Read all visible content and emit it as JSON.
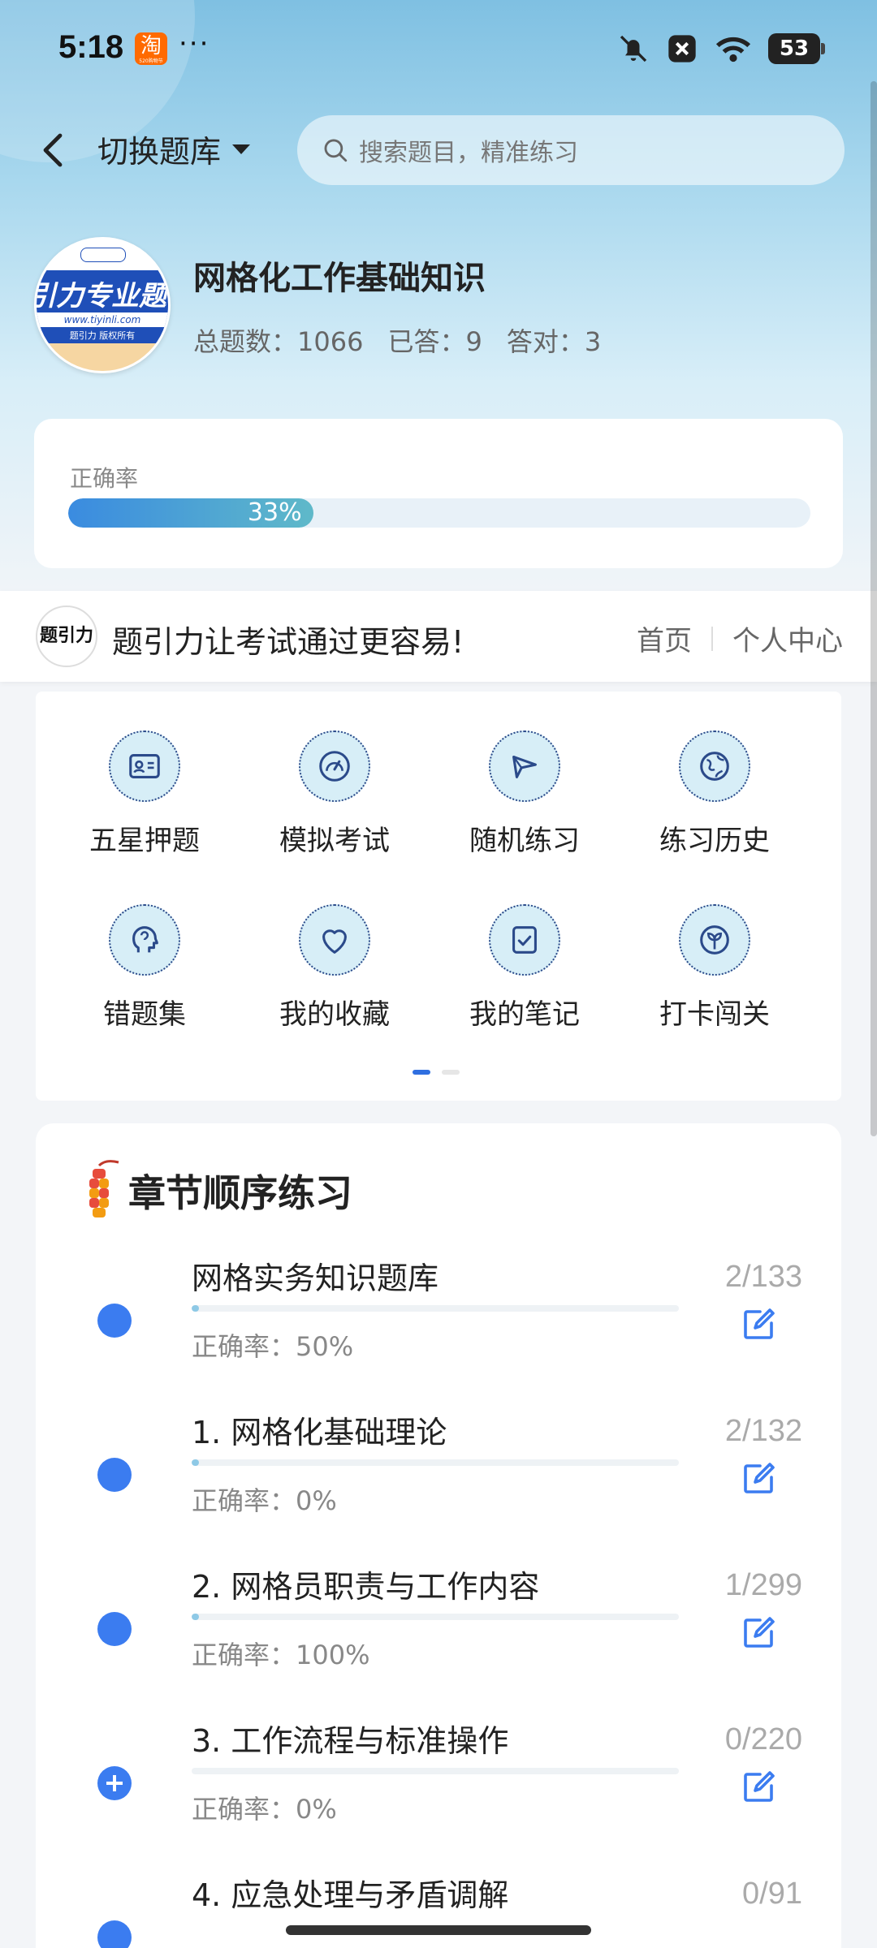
{
  "status_bar": {
    "time": "5:18",
    "app_badge": "淘",
    "app_badge_sub": "520购物节",
    "more": "···",
    "battery": "53"
  },
  "nav": {
    "switch_label": "切换题库",
    "search_placeholder": "搜索题目，精准练习"
  },
  "bank": {
    "avatar_text": "引力专业题",
    "avatar_url": "www.tiyinli.com",
    "avatar_copyright": "题引力 版权所有",
    "title": "网格化工作基础知识",
    "stats": {
      "total_label": "总题数：1066",
      "answered_label": "已答：9",
      "correct_label": "答对：3"
    }
  },
  "accuracy": {
    "label": "正确率",
    "percent_text": "33%",
    "value": 0.33
  },
  "banner": {
    "logo_text": "题引力",
    "slogan": "题引力让考试通过更容易!",
    "links": [
      "首页",
      "个人中心"
    ]
  },
  "features": [
    {
      "label": "五星押题",
      "icon": "id-card-icon"
    },
    {
      "label": "模拟考试",
      "icon": "gauge-icon"
    },
    {
      "label": "随机练习",
      "icon": "shuffle-icon"
    },
    {
      "label": "练习历史",
      "icon": "globe-icon"
    },
    {
      "label": "错题集",
      "icon": "brain-head-icon"
    },
    {
      "label": "我的收藏",
      "icon": "heart-icon"
    },
    {
      "label": "我的笔记",
      "icon": "note-check-icon"
    },
    {
      "label": "打卡闯关",
      "icon": "sprout-icon"
    }
  ],
  "pager": {
    "pages": 2,
    "active": 0
  },
  "chapters_section": {
    "title": "章节顺序练习",
    "items": [
      {
        "name": "网格实务知识题库",
        "count": "2/133",
        "accuracy": "正确率：50%",
        "progress": 0.015,
        "status": "dot"
      },
      {
        "name": "1. 网格化基础理论",
        "count": "2/132",
        "accuracy": "正确率：0%",
        "progress": 0.015,
        "status": "dot"
      },
      {
        "name": "2. 网格员职责与工作内容",
        "count": "1/299",
        "accuracy": "正确率：100%",
        "progress": 0.003,
        "status": "dot"
      },
      {
        "name": "3. 工作流程与标准操作",
        "count": "0/220",
        "accuracy": "正确率：0%",
        "progress": 0,
        "status": "plus"
      },
      {
        "name": "4. 应急处理与矛盾调解",
        "count": "0/91",
        "accuracy": "",
        "progress": 0,
        "status": "dot"
      }
    ]
  },
  "colors": {
    "accent": "#3b7cf0",
    "icon_bg": "#d7eef7",
    "icon_stroke": "#2b4a8a"
  }
}
